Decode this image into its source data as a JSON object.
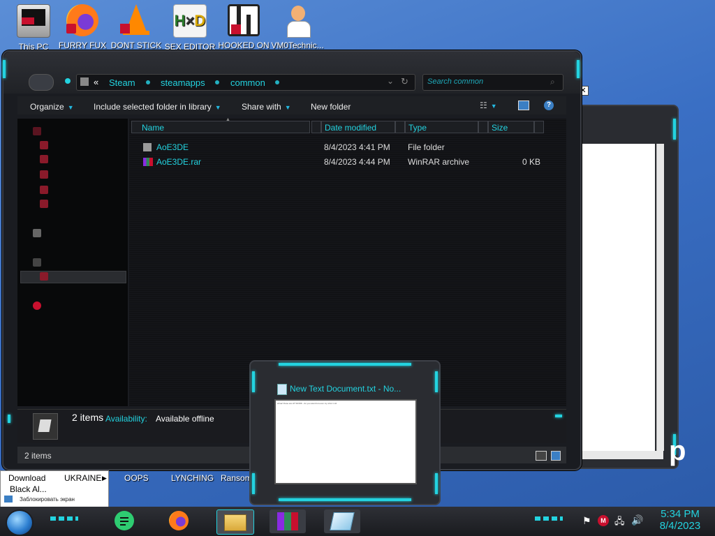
{
  "desktop": {
    "icons": [
      {
        "label": "This PC",
        "icon": "computer-icon"
      },
      {
        "label": "FURRY FUX",
        "icon": "firefox-icon"
      },
      {
        "label": "DONT STICK",
        "icon": "vlc-icon"
      },
      {
        "label": "SEX EDITOR",
        "icon": "hxd-icon"
      },
      {
        "label": "HOOKED ON",
        "icon": "maze-icon"
      },
      {
        "label": "VM0Technic...",
        "icon": "doctor-icon"
      }
    ],
    "bottom_labels": [
      "Download",
      "UKRAINE",
      "OOPS",
      "LYNCHING",
      "Ransom"
    ],
    "bottom_sub": "Black Al...",
    "lock_text": "Заблокировать экран"
  },
  "explorer": {
    "breadcrumb": {
      "prefix": "«",
      "items": [
        "Steam",
        "steamapps",
        "common"
      ]
    },
    "search_placeholder": "Search common",
    "toolbar": {
      "organize": "Organize",
      "include": "Include selected folder in library",
      "share": "Share with",
      "new_folder": "New folder"
    },
    "columns": {
      "name": "Name",
      "date": "Date modified",
      "type": "Type",
      "size": "Size"
    },
    "files": [
      {
        "name": "AoE3DE",
        "date": "8/4/2023 4:41 PM",
        "type": "File folder",
        "size": ""
      },
      {
        "name": "AoE3DE.rar",
        "date": "8/4/2023 4:44 PM",
        "type": "WinRAR archive",
        "size": "0 KB"
      }
    ],
    "details": {
      "count": "2 items",
      "availability_label": "Availability:",
      "availability_value": "Available offline"
    },
    "status": "2 items"
  },
  "preview": {
    "title": "New Text Document.txt - No...",
    "content": "whoa! those are AT WORK - do you want but even my shot 1 HJ"
  },
  "taskbar": {
    "time": "5:34 PM",
    "date": "8/4/2023"
  },
  "colors": {
    "accent": "#23d3e0",
    "frame": "#2a2c31",
    "desktop": "#3a6fc4"
  }
}
